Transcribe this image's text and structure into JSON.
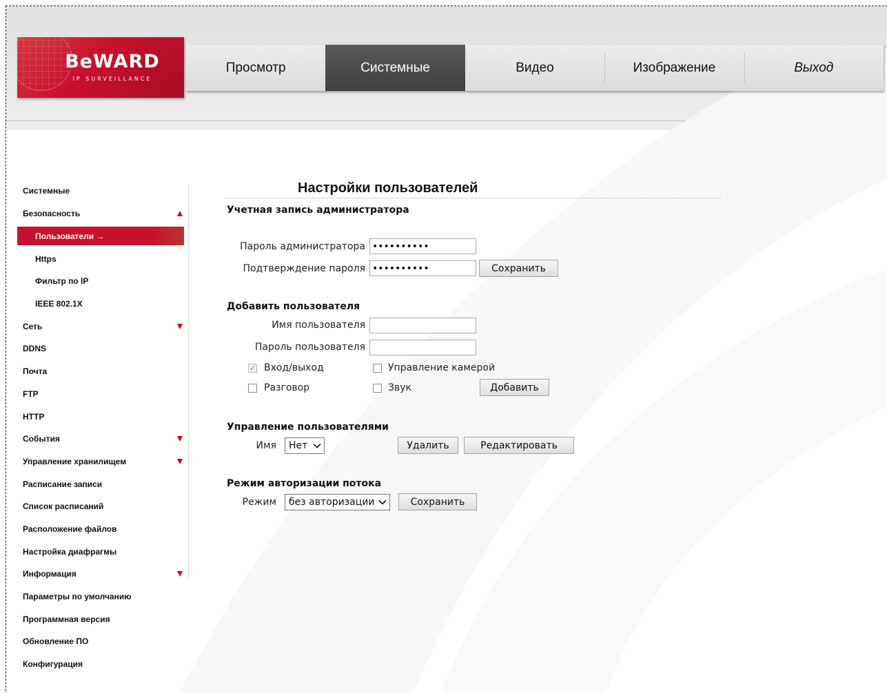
{
  "logo": {
    "brand": "BeWARD",
    "tagline": "IP SURVEILLANCE"
  },
  "nav": {
    "items": [
      {
        "label": "Просмотр"
      },
      {
        "label": "Системные"
      },
      {
        "label": "Видео"
      },
      {
        "label": "Изображение"
      },
      {
        "label": "Выход"
      }
    ],
    "active": "Системные"
  },
  "sidebar": {
    "items": [
      {
        "label": "Системные"
      },
      {
        "label": "Безопасность"
      },
      {
        "label": "Пользователи →"
      },
      {
        "label": "Https"
      },
      {
        "label": "Фильтр по IP"
      },
      {
        "label": "IEEE 802.1X"
      },
      {
        "label": "Сеть"
      },
      {
        "label": "DDNS"
      },
      {
        "label": "Почта"
      },
      {
        "label": "FTP"
      },
      {
        "label": "HTTP"
      },
      {
        "label": "События"
      },
      {
        "label": "Управление хранилищем"
      },
      {
        "label": "Расписание записи"
      },
      {
        "label": "Список расписаний"
      },
      {
        "label": "Расположение файлов"
      },
      {
        "label": "Настройка диафрагмы"
      },
      {
        "label": "Информация"
      },
      {
        "label": "Параметры по умолчанию"
      },
      {
        "label": "Программная версия"
      },
      {
        "label": "Обновление ПО"
      },
      {
        "label": "Конфигурация"
      }
    ]
  },
  "page": {
    "title": "Настройки пользователей",
    "admin": {
      "section": "Учетная запись администратора",
      "password_label": "Пароль администратора",
      "password_value": "••••••••••",
      "confirm_label": "Подтверждение пароля",
      "confirm_value": "••••••••••",
      "save_label": "Сохранить"
    },
    "add_user": {
      "section": "Добавить пользователя",
      "name_label": "Имя пользователя",
      "name_value": "",
      "password_label": "Пароль пользователя",
      "password_value": "",
      "perm_login": "Вход/выход",
      "perm_camera": "Управление камерой",
      "perm_talk": "Разговор",
      "perm_sound": "Звук",
      "add_label": "Добавить"
    },
    "manage": {
      "section": "Управление пользователями",
      "name_label": "Имя",
      "name_selected": "Нет",
      "delete_label": "Удалить",
      "edit_label": "Редактировать"
    },
    "stream_auth": {
      "section": "Режим авторизации потока",
      "mode_label": "Режим",
      "mode_selected": "без авторизации",
      "save_label": "Сохранить"
    }
  },
  "colors": {
    "brand_red": "#c8102e",
    "active_tab": "#4a4a4a",
    "arrow_red": "#d0021b"
  }
}
